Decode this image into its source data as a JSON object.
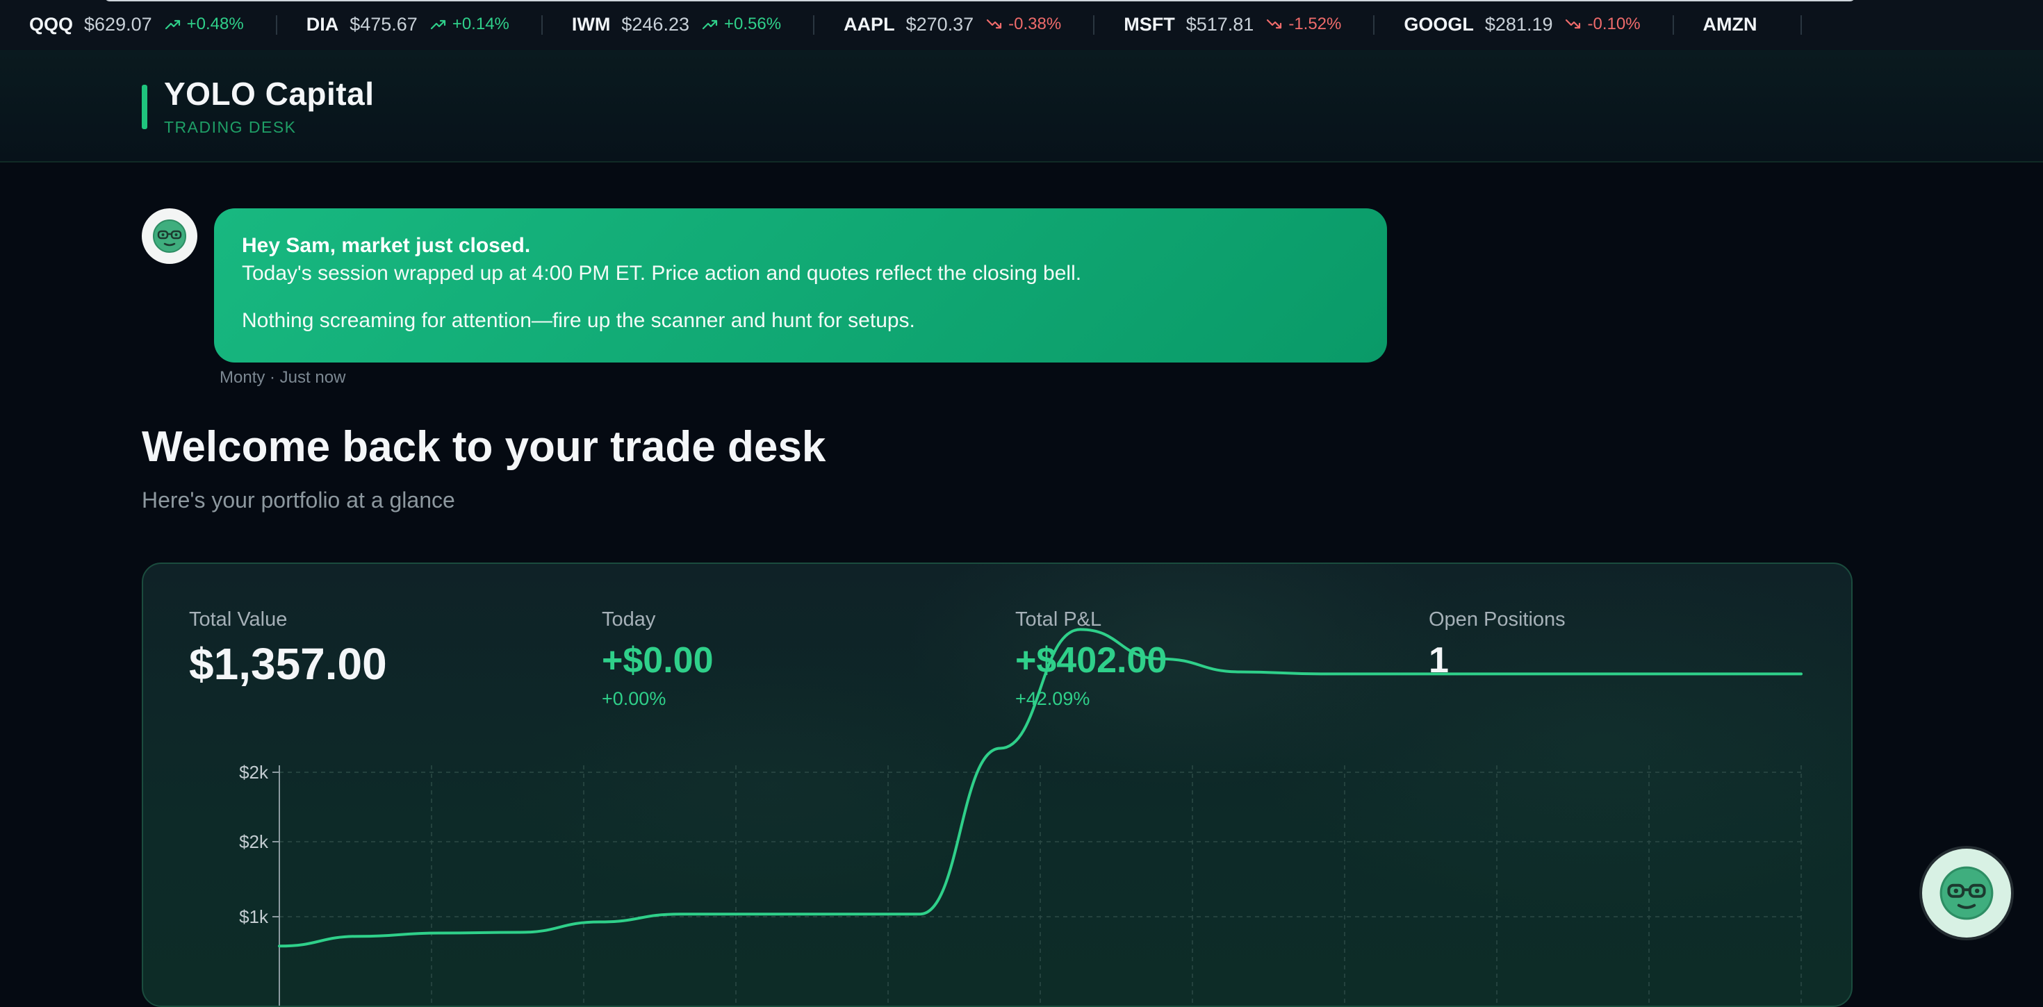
{
  "ticker": [
    {
      "symbol": "QQQ",
      "price": "$629.07",
      "change": "+0.48%",
      "direction": "up"
    },
    {
      "symbol": "DIA",
      "price": "$475.67",
      "change": "+0.14%",
      "direction": "up"
    },
    {
      "symbol": "IWM",
      "price": "$246.23",
      "change": "+0.56%",
      "direction": "up"
    },
    {
      "symbol": "AAPL",
      "price": "$270.37",
      "change": "-0.38%",
      "direction": "down"
    },
    {
      "symbol": "MSFT",
      "price": "$517.81",
      "change": "-1.52%",
      "direction": "down"
    },
    {
      "symbol": "GOOGL",
      "price": "$281.19",
      "change": "-0.10%",
      "direction": "down"
    },
    {
      "symbol": "AMZN",
      "price": "",
      "change": "",
      "direction": "up"
    }
  ],
  "brand": {
    "name": "YOLO Capital",
    "subtitle": "TRADING DESK"
  },
  "chat": {
    "title": "Hey Sam, market just closed.",
    "line1": "Today's session wrapped up at 4:00 PM ET. Price action and quotes reflect the closing bell.",
    "line2": "Nothing screaming for attention—fire up the scanner and hunt for setups.",
    "meta": "Monty · Just now"
  },
  "welcome": {
    "title": "Welcome back to your trade desk",
    "subtitle": "Here's your portfolio at a glance"
  },
  "stats": {
    "total_value": {
      "label": "Total Value",
      "value": "$1,357.00"
    },
    "today": {
      "label": "Today",
      "value": "+$0.00",
      "pct": "+0.00%"
    },
    "total_pnl": {
      "label": "Total P&L",
      "value": "+$402.00",
      "pct": "+42.09%"
    },
    "open_positions": {
      "label": "Open Positions",
      "value": "1"
    }
  },
  "colors": {
    "accent": "#2fd08a",
    "up": "#2fd08a",
    "down": "#ef6b6b",
    "bubble": "#12ad76"
  },
  "chart_data": {
    "type": "line",
    "title": "",
    "xlabel": "",
    "ylabel": "",
    "y_tick_labels": [
      "$2k",
      "$2k",
      "$1k"
    ],
    "grid": true,
    "series": [
      {
        "values": [
          955,
          970,
          975,
          976,
          992,
          1004,
          1004,
          1004,
          1004,
          1258,
          1440,
          1395,
          1375,
          1372,
          1372,
          1372,
          1372,
          1372,
          1372,
          1372
        ]
      }
    ]
  }
}
